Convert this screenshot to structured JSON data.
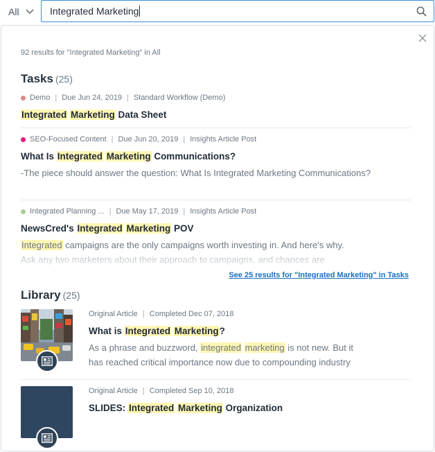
{
  "search": {
    "scope": "All",
    "query": "Integrated Marketing"
  },
  "summary": "92 results for \"Integrated Marketing\" in All",
  "tasks": {
    "title": "Tasks",
    "count": "(25)",
    "items": [
      {
        "dot_color": "#e08a85",
        "project": "Demo",
        "due": "Due Jun 24, 2019",
        "workflow": "Standard Workflow (Demo)",
        "title_pre": "",
        "title_h1": "Integrated",
        "title_mid": " ",
        "title_h2": "Marketing",
        "title_post": " Data Sheet"
      },
      {
        "dot_color": "#e8197d",
        "project": "SEO-Focused Content",
        "due": "Due Jun 20, 2019",
        "workflow": "Insights Article Post",
        "title_pre": "What Is ",
        "title_h1": "Integrated",
        "title_mid": " ",
        "title_h2": "Marketing",
        "title_post": " Communications?",
        "desc": "-The piece should answer the question: What Is Integrated Marketing Communications?"
      },
      {
        "dot_color": "#a8d08d",
        "project": "Integrated Planning ...",
        "due": "Due May 17, 2019",
        "workflow": "Insights Article Post",
        "title_pre": "NewsCred's ",
        "title_h1": "Integrated",
        "title_mid": " ",
        "title_h2": "Marketing",
        "title_post": " POV",
        "desc_h": "Integrated",
        "desc_rest": " campaigns are the only campaigns worth investing in. And here's why.",
        "desc_line2": "Ask any two marketers about their approach to campaigns, and chances are"
      }
    ],
    "see_more": "See 25 results for \"Integrated Marketing\" in Tasks"
  },
  "library": {
    "title": "Library",
    "count": "(25)",
    "items": [
      {
        "type": "Original Article",
        "status": "Completed Dec 07, 2018",
        "title_pre": "What is ",
        "title_h1": "Integrated",
        "title_mid": " ",
        "title_h2": "Marketing",
        "title_post": "?",
        "desc_pre": "As a phrase and buzzword, ",
        "desc_h1": "integrated",
        "desc_mid": " ",
        "desc_h2": "marketing",
        "desc_post": " is not new. But it",
        "desc_line2": "has reached critical importance now due to compounding industry"
      },
      {
        "type": "Original Article",
        "status": "Completed Sep 10, 2018",
        "title_pre": "SLIDES: ",
        "title_h1": "Integrated",
        "title_mid": " ",
        "title_h2": "Marketing",
        "title_post": " Organization"
      }
    ]
  },
  "colors": {
    "accent": "#3a8dde",
    "link": "#1a6fc4",
    "highlight": "#fff6b3"
  }
}
